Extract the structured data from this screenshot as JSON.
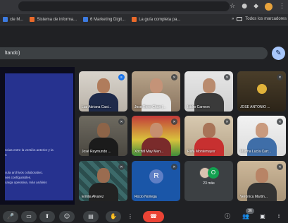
{
  "browser": {
    "bookmarks": [
      {
        "label": "cle M...",
        "icon": "page-icon"
      },
      {
        "label": "Sistema de informa...",
        "icon": "orange-logo-icon"
      },
      {
        "label": "6 Marketing Digit...",
        "icon": "blue-logo-icon"
      },
      {
        "label": "La guía completa pa...",
        "icon": "orange-logo-icon"
      }
    ],
    "bookmarks_overflow": "»",
    "all_bookmarks_label": "Todos los marcadores"
  },
  "meeting": {
    "title_text": "ltando)",
    "presentation": {
      "lines": [
        "ncias entre la versión anterior y la",
        "n",
        "",
        "cula archivos colaborativo.",
        "nes configurables.",
        "carga operativa, más análisis"
      ]
    },
    "participants": [
      {
        "name": "Luz Adriana Cast...",
        "speaking": true
      },
      {
        "name": "Jose Rene Chan (...",
        "speaking": false
      },
      {
        "name": "Isidro Carreon",
        "speaking": false
      },
      {
        "name": "JOSE ANTONIO ...",
        "speaking": false
      },
      {
        "name": "José Raymundo ...",
        "speaking": false
      },
      {
        "name": "Xóchitl May Men...",
        "speaking": false
      },
      {
        "name": "Rafa Montemayor",
        "speaking": false
      },
      {
        "name": "Martha Lucía Carr...",
        "speaking": false
      },
      {
        "name": "Emilia Alvarez",
        "speaking": false
      },
      {
        "name": "Rocio Noriega",
        "avatar_letter": "R",
        "speaking": false
      },
      {
        "more_count": "23 más",
        "more_letter": "O"
      },
      {
        "name": "Verónica Martin...",
        "speaking": false
      }
    ],
    "participants_badge": "36"
  },
  "colors": {
    "leave": "#ea4335",
    "accent": "#a8c7fa",
    "speaking": "#1a73e8"
  }
}
